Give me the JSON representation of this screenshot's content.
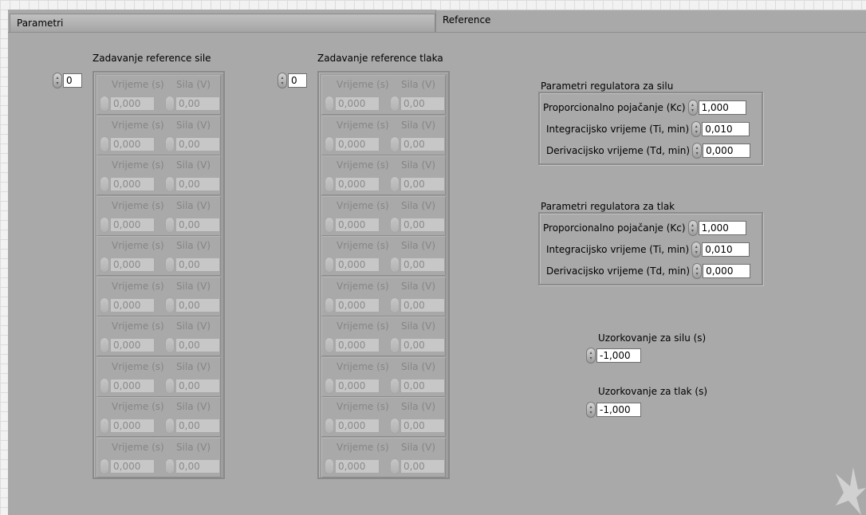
{
  "tabs": [
    {
      "label": "Parametri",
      "active": false
    },
    {
      "label": "Reference",
      "active": true
    }
  ],
  "force_reference": {
    "title": "Zadavanje reference sile",
    "index": "0",
    "col_time": "Vrijeme (s)",
    "col_value": "Sila (V)",
    "rows": [
      {
        "time": "0,000",
        "value": "0,00"
      },
      {
        "time": "0,000",
        "value": "0,00"
      },
      {
        "time": "0,000",
        "value": "0,00"
      },
      {
        "time": "0,000",
        "value": "0,00"
      },
      {
        "time": "0,000",
        "value": "0,00"
      },
      {
        "time": "0,000",
        "value": "0,00"
      },
      {
        "time": "0,000",
        "value": "0,00"
      },
      {
        "time": "0,000",
        "value": "0,00"
      },
      {
        "time": "0,000",
        "value": "0,00"
      },
      {
        "time": "0,000",
        "value": "0,00"
      }
    ]
  },
  "pressure_reference": {
    "title": "Zadavanje reference tlaka",
    "index": "0",
    "col_time": "Vrijeme (s)",
    "col_value": "Sila (V)",
    "rows": [
      {
        "time": "0,000",
        "value": "0,00"
      },
      {
        "time": "0,000",
        "value": "0,00"
      },
      {
        "time": "0,000",
        "value": "0,00"
      },
      {
        "time": "0,000",
        "value": "0,00"
      },
      {
        "time": "0,000",
        "value": "0,00"
      },
      {
        "time": "0,000",
        "value": "0,00"
      },
      {
        "time": "0,000",
        "value": "0,00"
      },
      {
        "time": "0,000",
        "value": "0,00"
      },
      {
        "time": "0,000",
        "value": "0,00"
      },
      {
        "time": "0,000",
        "value": "0,00"
      }
    ]
  },
  "force_controller": {
    "title": "Parametri regulatora za silu",
    "kc_label": "Proporcionalno pojačanje (Kc)",
    "kc_value": "1,000",
    "ti_label": "Integracijsko vrijeme (Ti, min)",
    "ti_value": "0,010",
    "td_label": "Derivacijsko vrijeme (Td, min)",
    "td_value": "0,000"
  },
  "pressure_controller": {
    "title": "Parametri regulatora za tlak",
    "kc_label": "Proporcionalno pojačanje (Kc)",
    "kc_value": "1,000",
    "ti_label": "Integracijsko vrijeme (Ti, min)",
    "ti_value": "0,010",
    "td_label": "Derivacijsko vrijeme (Td, min)",
    "td_value": "0,000"
  },
  "sampling_force": {
    "label": "Uzorkovanje za silu (s)",
    "value": "-1,000"
  },
  "sampling_pressure": {
    "label": "Uzorkovanje za tlak (s)",
    "value": "-1,000"
  },
  "colors": {
    "panel": "#a9a9a9",
    "frame": "#9e9e9e",
    "disabled_text": "#858585"
  },
  "icons": {
    "spin": "spin-arrows-icon",
    "watermark": "labview-logo-icon"
  }
}
